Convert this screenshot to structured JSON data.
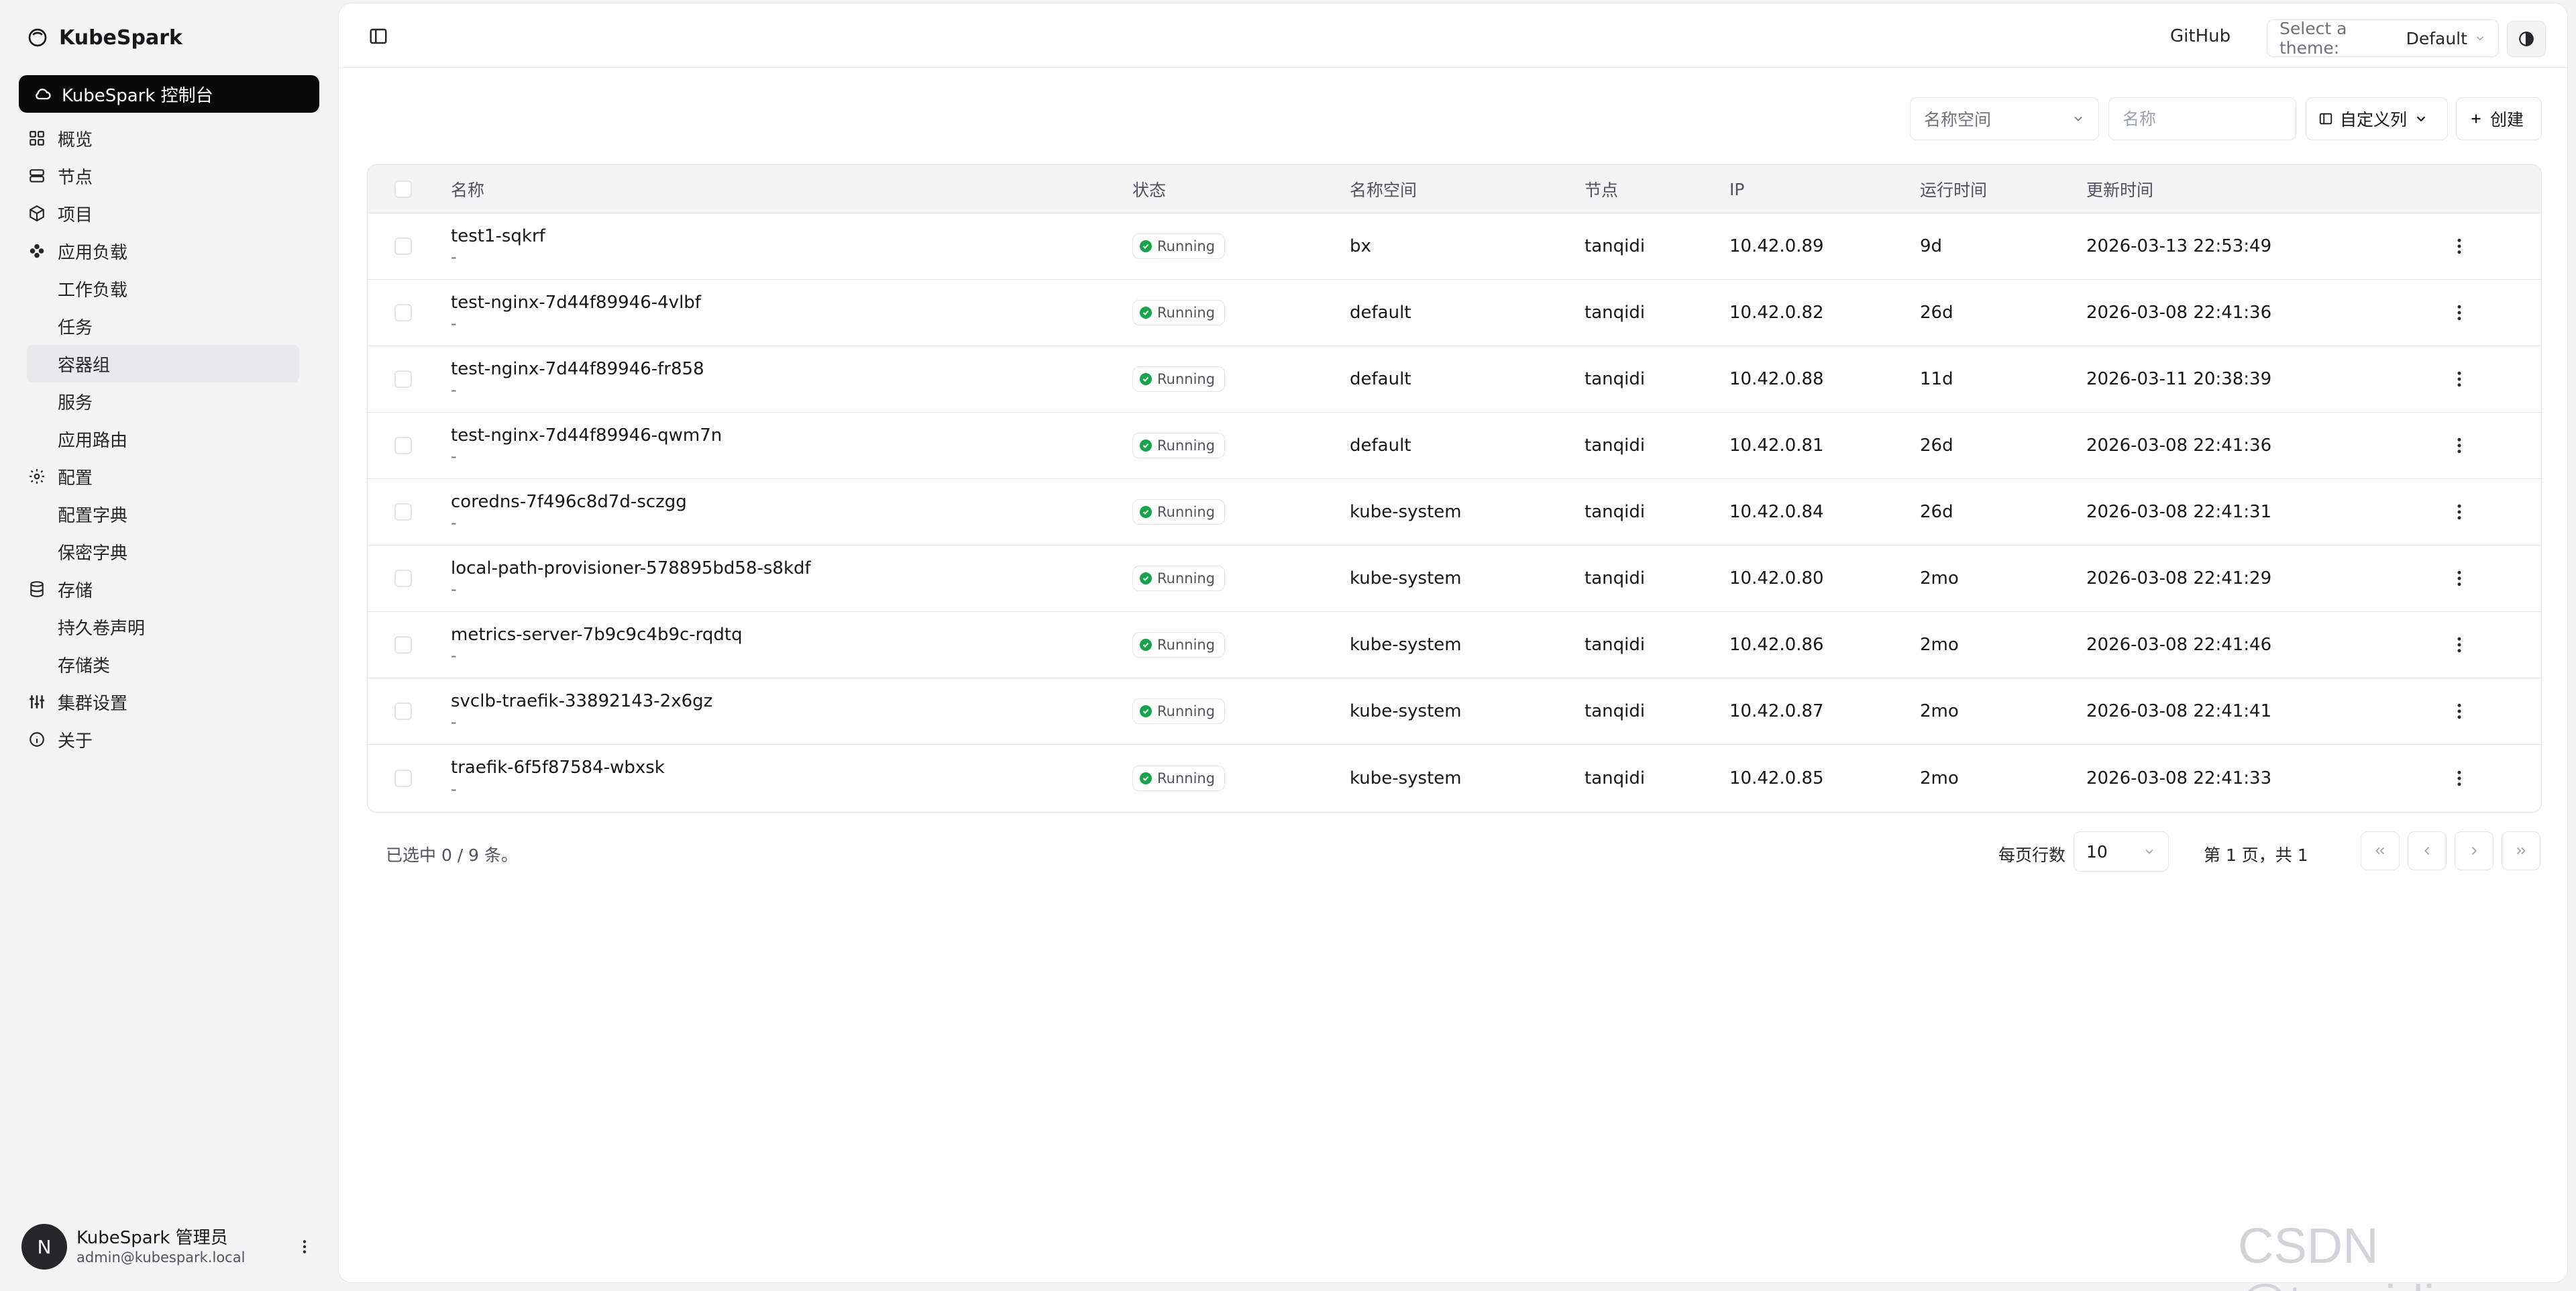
{
  "app": {
    "brand": "KubeSpark",
    "console_label": "KubeSpark 控制台"
  },
  "sidebar": {
    "items": [
      {
        "label": "概览",
        "icon": "grid-icon"
      },
      {
        "label": "节点",
        "icon": "server-icon"
      },
      {
        "label": "项目",
        "icon": "box-icon"
      },
      {
        "label": "应用负载",
        "icon": "sparkle-icon",
        "children": [
          "工作负载",
          "任务",
          "容器组",
          "服务",
          "应用路由"
        ]
      },
      {
        "label": "配置",
        "icon": "gear-icon",
        "children": [
          "配置字典",
          "保密字典"
        ]
      },
      {
        "label": "存储",
        "icon": "database-icon",
        "children": [
          "持久卷声明",
          "存储类"
        ]
      },
      {
        "label": "集群设置",
        "icon": "sliders-icon"
      },
      {
        "label": "关于",
        "icon": "info-icon"
      }
    ],
    "active_item": "容器组"
  },
  "user": {
    "initial": "N",
    "name": "KubeSpark 管理员",
    "email": "admin@kubespark.local"
  },
  "topbar": {
    "github": "GitHub",
    "theme_label": "Select a theme:",
    "theme_value": "Default"
  },
  "toolbar": {
    "namespace_placeholder": "名称空间",
    "name_placeholder": "名称",
    "columns_label": "自定义列",
    "create_label": "创建"
  },
  "table": {
    "headers": {
      "name": "名称",
      "status": "状态",
      "namespace": "名称空间",
      "node": "节点",
      "ip": "IP",
      "age": "运行时间",
      "updated": "更新时间"
    },
    "rows": [
      {
        "name": "test1-sqkrf",
        "sub": "-",
        "status": "Running",
        "namespace": "bx",
        "node": "tanqidi",
        "ip": "10.42.0.89",
        "age": "9d",
        "updated": "2026-03-13 22:53:49"
      },
      {
        "name": "test-nginx-7d44f89946-4vlbf",
        "sub": "-",
        "status": "Running",
        "namespace": "default",
        "node": "tanqidi",
        "ip": "10.42.0.82",
        "age": "26d",
        "updated": "2026-03-08 22:41:36"
      },
      {
        "name": "test-nginx-7d44f89946-fr858",
        "sub": "-",
        "status": "Running",
        "namespace": "default",
        "node": "tanqidi",
        "ip": "10.42.0.88",
        "age": "11d",
        "updated": "2026-03-11 20:38:39"
      },
      {
        "name": "test-nginx-7d44f89946-qwm7n",
        "sub": "-",
        "status": "Running",
        "namespace": "default",
        "node": "tanqidi",
        "ip": "10.42.0.81",
        "age": "26d",
        "updated": "2026-03-08 22:41:36"
      },
      {
        "name": "coredns-7f496c8d7d-sczgg",
        "sub": "-",
        "status": "Running",
        "namespace": "kube-system",
        "node": "tanqidi",
        "ip": "10.42.0.84",
        "age": "26d",
        "updated": "2026-03-08 22:41:31"
      },
      {
        "name": "local-path-provisioner-578895bd58-s8kdf",
        "sub": "-",
        "status": "Running",
        "namespace": "kube-system",
        "node": "tanqidi",
        "ip": "10.42.0.80",
        "age": "2mo",
        "updated": "2026-03-08 22:41:29"
      },
      {
        "name": "metrics-server-7b9c9c4b9c-rqdtq",
        "sub": "-",
        "status": "Running",
        "namespace": "kube-system",
        "node": "tanqidi",
        "ip": "10.42.0.86",
        "age": "2mo",
        "updated": "2026-03-08 22:41:46"
      },
      {
        "name": "svclb-traefik-33892143-2x6gz",
        "sub": "-",
        "status": "Running",
        "namespace": "kube-system",
        "node": "tanqidi",
        "ip": "10.42.0.87",
        "age": "2mo",
        "updated": "2026-03-08 22:41:41"
      },
      {
        "name": "traefik-6f5f87584-wbxsk",
        "sub": "-",
        "status": "Running",
        "namespace": "kube-system",
        "node": "tanqidi",
        "ip": "10.42.0.85",
        "age": "2mo",
        "updated": "2026-03-08 22:41:33"
      }
    ]
  },
  "footer": {
    "selected_info": "已选中 0 / 9 条。",
    "rows_per_page_label": "每页行数",
    "rows_per_page": "10",
    "page_info": "第 1 页，共 1"
  },
  "watermark": "CSDN @tanqidi",
  "colors": {
    "accent": "#0a0a0a",
    "status_running": "#16a34a"
  }
}
